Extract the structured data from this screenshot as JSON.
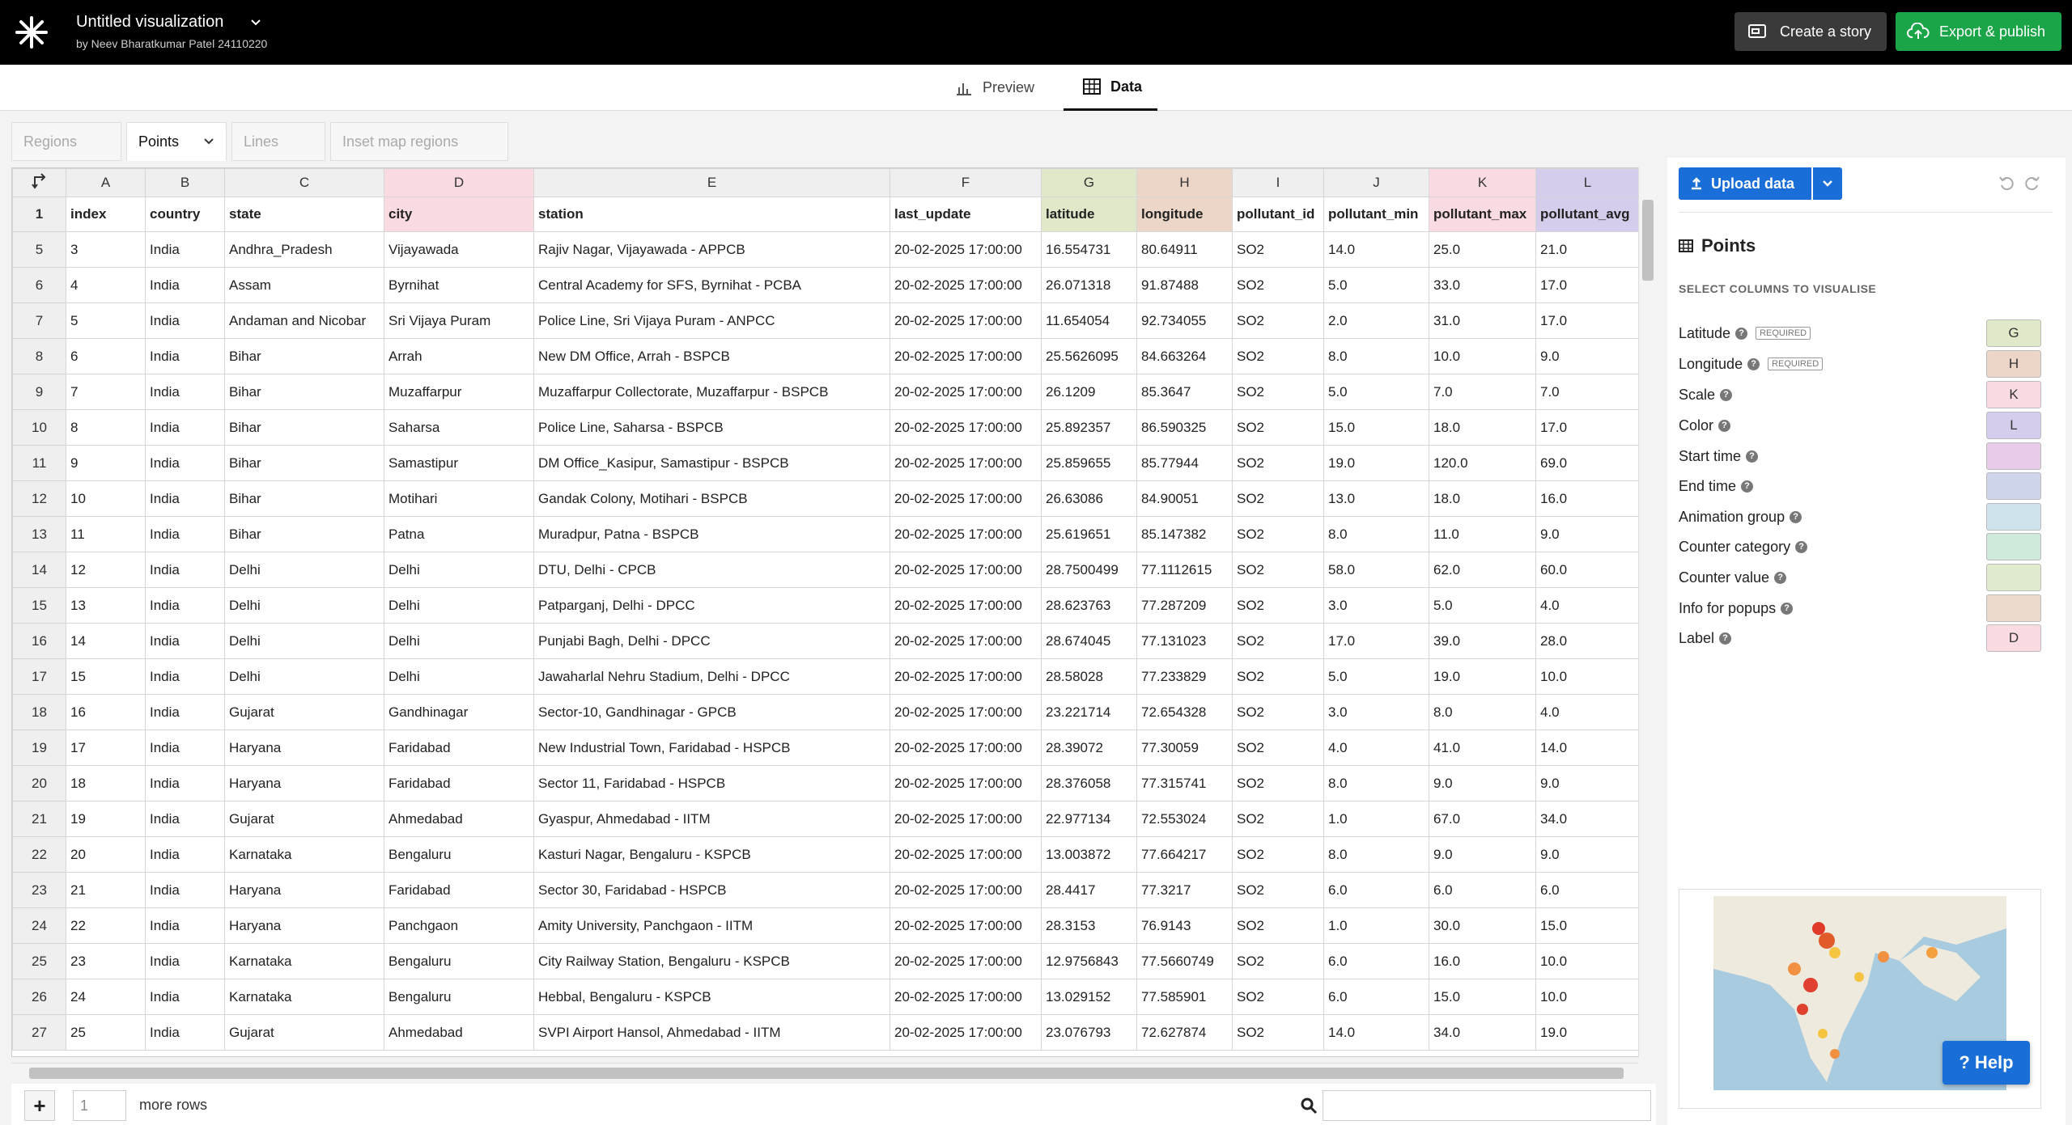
{
  "header": {
    "title": "Untitled visualization",
    "subtitle": "by Neev Bharatkumar Patel 24110220",
    "create_story_label": "Create a story",
    "export_label": "Export & publish"
  },
  "view_tabs": [
    {
      "label": "Preview",
      "icon": "bar-chart-icon",
      "active": false
    },
    {
      "label": "Data",
      "icon": "table-icon",
      "active": true
    }
  ],
  "sheet_tabs": [
    {
      "label": "Regions",
      "active": false
    },
    {
      "label": "Points",
      "active": true
    },
    {
      "label": "Lines",
      "active": false
    },
    {
      "label": "Inset map regions",
      "active": false
    }
  ],
  "grid": {
    "column_letters": [
      "A",
      "B",
      "C",
      "D",
      "E",
      "F",
      "G",
      "H",
      "I",
      "J",
      "K",
      "L"
    ],
    "column_colors": {
      "D": "#fbdbe2",
      "G": "#dfe9c9",
      "H": "#ecd6c7",
      "K": "#fbdbe2",
      "L": "#d6cdec"
    },
    "header_row_num": "1",
    "headers": [
      "index",
      "country",
      "state",
      "city",
      "station",
      "last_update",
      "latitude",
      "longitude",
      "pollutant_id",
      "pollutant_min",
      "pollutant_max",
      "pollutant_avg"
    ],
    "rows": [
      {
        "n": "5",
        "c": [
          "3",
          "India",
          "Andhra_Pradesh",
          "Vijayawada",
          "Rajiv Nagar, Vijayawada - APPCB",
          "20-02-2025 17:00:00",
          "16.554731",
          "80.64911",
          "SO2",
          "14.0",
          "25.0",
          "21.0"
        ]
      },
      {
        "n": "6",
        "c": [
          "4",
          "India",
          "Assam",
          "Byrnihat",
          "Central Academy for SFS, Byrnihat - PCBA",
          "20-02-2025 17:00:00",
          "26.071318",
          "91.87488",
          "SO2",
          "5.0",
          "33.0",
          "17.0"
        ]
      },
      {
        "n": "7",
        "c": [
          "5",
          "India",
          "Andaman and Nicobar",
          "Sri Vijaya Puram",
          "Police Line, Sri Vijaya Puram - ANPCC",
          "20-02-2025 17:00:00",
          "11.654054",
          "92.734055",
          "SO2",
          "2.0",
          "31.0",
          "17.0"
        ]
      },
      {
        "n": "8",
        "c": [
          "6",
          "India",
          "Bihar",
          "Arrah",
          "New DM Office, Arrah - BSPCB",
          "20-02-2025 17:00:00",
          "25.5626095",
          "84.663264",
          "SO2",
          "8.0",
          "10.0",
          "9.0"
        ]
      },
      {
        "n": "9",
        "c": [
          "7",
          "India",
          "Bihar",
          "Muzaffarpur",
          "Muzaffarpur Collectorate, Muzaffarpur - BSPCB",
          "20-02-2025 17:00:00",
          "26.1209",
          "85.3647",
          "SO2",
          "5.0",
          "7.0",
          "7.0"
        ]
      },
      {
        "n": "10",
        "c": [
          "8",
          "India",
          "Bihar",
          "Saharsa",
          "Police Line, Saharsa - BSPCB",
          "20-02-2025 17:00:00",
          "25.892357",
          "86.590325",
          "SO2",
          "15.0",
          "18.0",
          "17.0"
        ]
      },
      {
        "n": "11",
        "c": [
          "9",
          "India",
          "Bihar",
          "Samastipur",
          "DM Office_Kasipur, Samastipur - BSPCB",
          "20-02-2025 17:00:00",
          "25.859655",
          "85.77944",
          "SO2",
          "19.0",
          "120.0",
          "69.0"
        ]
      },
      {
        "n": "12",
        "c": [
          "10",
          "India",
          "Bihar",
          "Motihari",
          "Gandak Colony, Motihari - BSPCB",
          "20-02-2025 17:00:00",
          "26.63086",
          "84.90051",
          "SO2",
          "13.0",
          "18.0",
          "16.0"
        ]
      },
      {
        "n": "13",
        "c": [
          "11",
          "India",
          "Bihar",
          "Patna",
          "Muradpur, Patna - BSPCB",
          "20-02-2025 17:00:00",
          "25.619651",
          "85.147382",
          "SO2",
          "8.0",
          "11.0",
          "9.0"
        ]
      },
      {
        "n": "14",
        "c": [
          "12",
          "India",
          "Delhi",
          "Delhi",
          "DTU, Delhi - CPCB",
          "20-02-2025 17:00:00",
          "28.7500499",
          "77.1112615",
          "SO2",
          "58.0",
          "62.0",
          "60.0"
        ]
      },
      {
        "n": "15",
        "c": [
          "13",
          "India",
          "Delhi",
          "Delhi",
          "Patparganj, Delhi - DPCC",
          "20-02-2025 17:00:00",
          "28.623763",
          "77.287209",
          "SO2",
          "3.0",
          "5.0",
          "4.0"
        ]
      },
      {
        "n": "16",
        "c": [
          "14",
          "India",
          "Delhi",
          "Delhi",
          "Punjabi Bagh, Delhi - DPCC",
          "20-02-2025 17:00:00",
          "28.674045",
          "77.131023",
          "SO2",
          "17.0",
          "39.0",
          "28.0"
        ]
      },
      {
        "n": "17",
        "c": [
          "15",
          "India",
          "Delhi",
          "Delhi",
          "Jawaharlal Nehru Stadium, Delhi - DPCC",
          "20-02-2025 17:00:00",
          "28.58028",
          "77.233829",
          "SO2",
          "5.0",
          "19.0",
          "10.0"
        ]
      },
      {
        "n": "18",
        "c": [
          "16",
          "India",
          "Gujarat",
          "Gandhinagar",
          "Sector-10, Gandhinagar - GPCB",
          "20-02-2025 17:00:00",
          "23.221714",
          "72.654328",
          "SO2",
          "3.0",
          "8.0",
          "4.0"
        ]
      },
      {
        "n": "19",
        "c": [
          "17",
          "India",
          "Haryana",
          "Faridabad",
          "New Industrial Town, Faridabad - HSPCB",
          "20-02-2025 17:00:00",
          "28.39072",
          "77.30059",
          "SO2",
          "4.0",
          "41.0",
          "14.0"
        ]
      },
      {
        "n": "20",
        "c": [
          "18",
          "India",
          "Haryana",
          "Faridabad",
          "Sector 11, Faridabad - HSPCB",
          "20-02-2025 17:00:00",
          "28.376058",
          "77.315741",
          "SO2",
          "8.0",
          "9.0",
          "9.0"
        ]
      },
      {
        "n": "21",
        "c": [
          "19",
          "India",
          "Gujarat",
          "Ahmedabad",
          "Gyaspur, Ahmedabad - IITM",
          "20-02-2025 17:00:00",
          "22.977134",
          "72.553024",
          "SO2",
          "1.0",
          "67.0",
          "34.0"
        ]
      },
      {
        "n": "22",
        "c": [
          "20",
          "India",
          "Karnataka",
          "Bengaluru",
          "Kasturi Nagar, Bengaluru - KSPCB",
          "20-02-2025 17:00:00",
          "13.003872",
          "77.664217",
          "SO2",
          "8.0",
          "9.0",
          "9.0"
        ]
      },
      {
        "n": "23",
        "c": [
          "21",
          "India",
          "Haryana",
          "Faridabad",
          "Sector 30, Faridabad - HSPCB",
          "20-02-2025 17:00:00",
          "28.4417",
          "77.3217",
          "SO2",
          "6.0",
          "6.0",
          "6.0"
        ]
      },
      {
        "n": "24",
        "c": [
          "22",
          "India",
          "Haryana",
          "Panchgaon",
          "Amity University, Panchgaon - IITM",
          "20-02-2025 17:00:00",
          "28.3153",
          "76.9143",
          "SO2",
          "1.0",
          "30.0",
          "15.0"
        ]
      },
      {
        "n": "25",
        "c": [
          "23",
          "India",
          "Karnataka",
          "Bengaluru",
          "City Railway Station, Bengaluru - KSPCB",
          "20-02-2025 17:00:00",
          "12.9756843",
          "77.5660749",
          "SO2",
          "6.0",
          "16.0",
          "10.0"
        ]
      },
      {
        "n": "26",
        "c": [
          "24",
          "India",
          "Karnataka",
          "Bengaluru",
          "Hebbal, Bengaluru - KSPCB",
          "20-02-2025 17:00:00",
          "13.029152",
          "77.585901",
          "SO2",
          "6.0",
          "15.0",
          "10.0"
        ]
      },
      {
        "n": "27",
        "c": [
          "25",
          "India",
          "Gujarat",
          "Ahmedabad",
          "SVPI Airport Hansol, Ahmedabad - IITM",
          "20-02-2025 17:00:00",
          "23.076793",
          "72.627874",
          "SO2",
          "14.0",
          "34.0",
          "19.0"
        ]
      }
    ]
  },
  "bottombar": {
    "add_label": "+",
    "rows_value": "1",
    "more_rows_label": "more rows"
  },
  "panel": {
    "upload_label": "Upload data",
    "points_title": "Points",
    "select_columns_label": "SELECT COLUMNS TO VISUALISE",
    "required_label": "REQUIRED",
    "bindings": [
      {
        "label": "Latitude",
        "required": true,
        "value": "G",
        "color": "#dfe9c9"
      },
      {
        "label": "Longitude",
        "required": true,
        "value": "H",
        "color": "#ecd6c7"
      },
      {
        "label": "Scale",
        "required": false,
        "value": "K",
        "color": "#fbdbe2"
      },
      {
        "label": "Color",
        "required": false,
        "value": "L",
        "color": "#d6cdec"
      },
      {
        "label": "Start time",
        "required": false,
        "value": "",
        "color": "#e8cbe8"
      },
      {
        "label": "End time",
        "required": false,
        "value": "",
        "color": "#cfd6ec"
      },
      {
        "label": "Animation group",
        "required": false,
        "value": "",
        "color": "#cfe3ec"
      },
      {
        "label": "Counter category",
        "required": false,
        "value": "",
        "color": "#cfeadb"
      },
      {
        "label": "Counter value",
        "required": false,
        "value": "",
        "color": "#e1ecce"
      },
      {
        "label": "Info for popups",
        "required": false,
        "value": "",
        "color": "#ecd9cd"
      },
      {
        "label": "Label",
        "required": false,
        "value": "D",
        "color": "#fbdbe2"
      }
    ],
    "help_label": "? Help"
  },
  "colors": {
    "accent_blue": "#1a6ed8",
    "export_green": "#1ba549"
  }
}
